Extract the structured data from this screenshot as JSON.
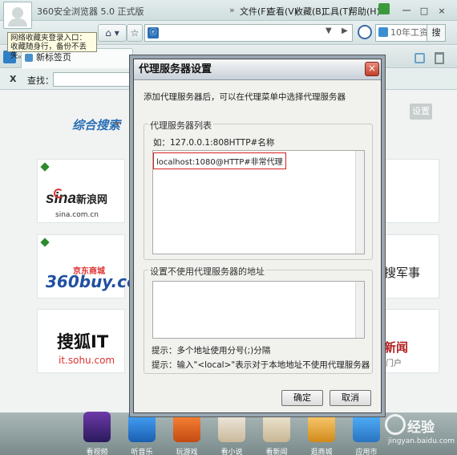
{
  "browser": {
    "title": "360安全浏览器 5.0 正式版",
    "menu": [
      "文件(F)",
      "查看(V)",
      "收藏(B)",
      "工具(T)",
      "帮助(H)"
    ],
    "menu_arrow": "»",
    "window_controls": [
      "一",
      "□",
      "×"
    ],
    "search_placeholder": "10年工资",
    "search_button": "搜",
    "tooltip": [
      "网络收藏夹登录入口：",
      "收藏随身行，备份不丢失。"
    ],
    "tab_label": "新标签页",
    "find_label": "查找：",
    "find_close": "X"
  },
  "newtab": {
    "search_logo": "综合搜索",
    "settings_button": "设置",
    "tiles": [
      {
        "name": "sina",
        "title": "新浪网",
        "brand": "sina",
        "url": "sina.com.cn"
      },
      {
        "name": "360buy",
        "title": "京东商城",
        "brand": "360buy.com"
      },
      {
        "name": "sohu-it",
        "title": "搜狐IT",
        "url": "it.sohu.com"
      }
    ],
    "right_tiles": [
      "搜军事",
      "新闻",
      "门户"
    ],
    "dock": [
      "看视频",
      "听音乐",
      "玩游戏",
      "看小说",
      "看新闻",
      "逛商城",
      "应用市"
    ]
  },
  "dialog": {
    "title": "代理服务器设置",
    "close": "×",
    "description": "添加代理服务器后，可以在代理菜单中选择代理服务器",
    "proxy_group": {
      "title": "代理服务器列表",
      "example": "如：127.0.0.1:808HTTP#名称",
      "entries": [
        "localhost:1080@HTTP#非常代理"
      ]
    },
    "bypass_group": {
      "title": "设置不使用代理服务器的地址",
      "entries": [],
      "hint1": "提示：多个地址使用分号(;)分隔",
      "hint2": "提示：输入\"<local>\"表示对于本地地址不使用代理服务器"
    },
    "ok": "确定",
    "cancel": "取消"
  },
  "watermark": {
    "brand": "经验",
    "url": "jingyan.baidu.com"
  },
  "colors": {
    "accent": "#2a6fb5",
    "highlight": "#d62020",
    "dialog_border": "#9aa7b4"
  }
}
